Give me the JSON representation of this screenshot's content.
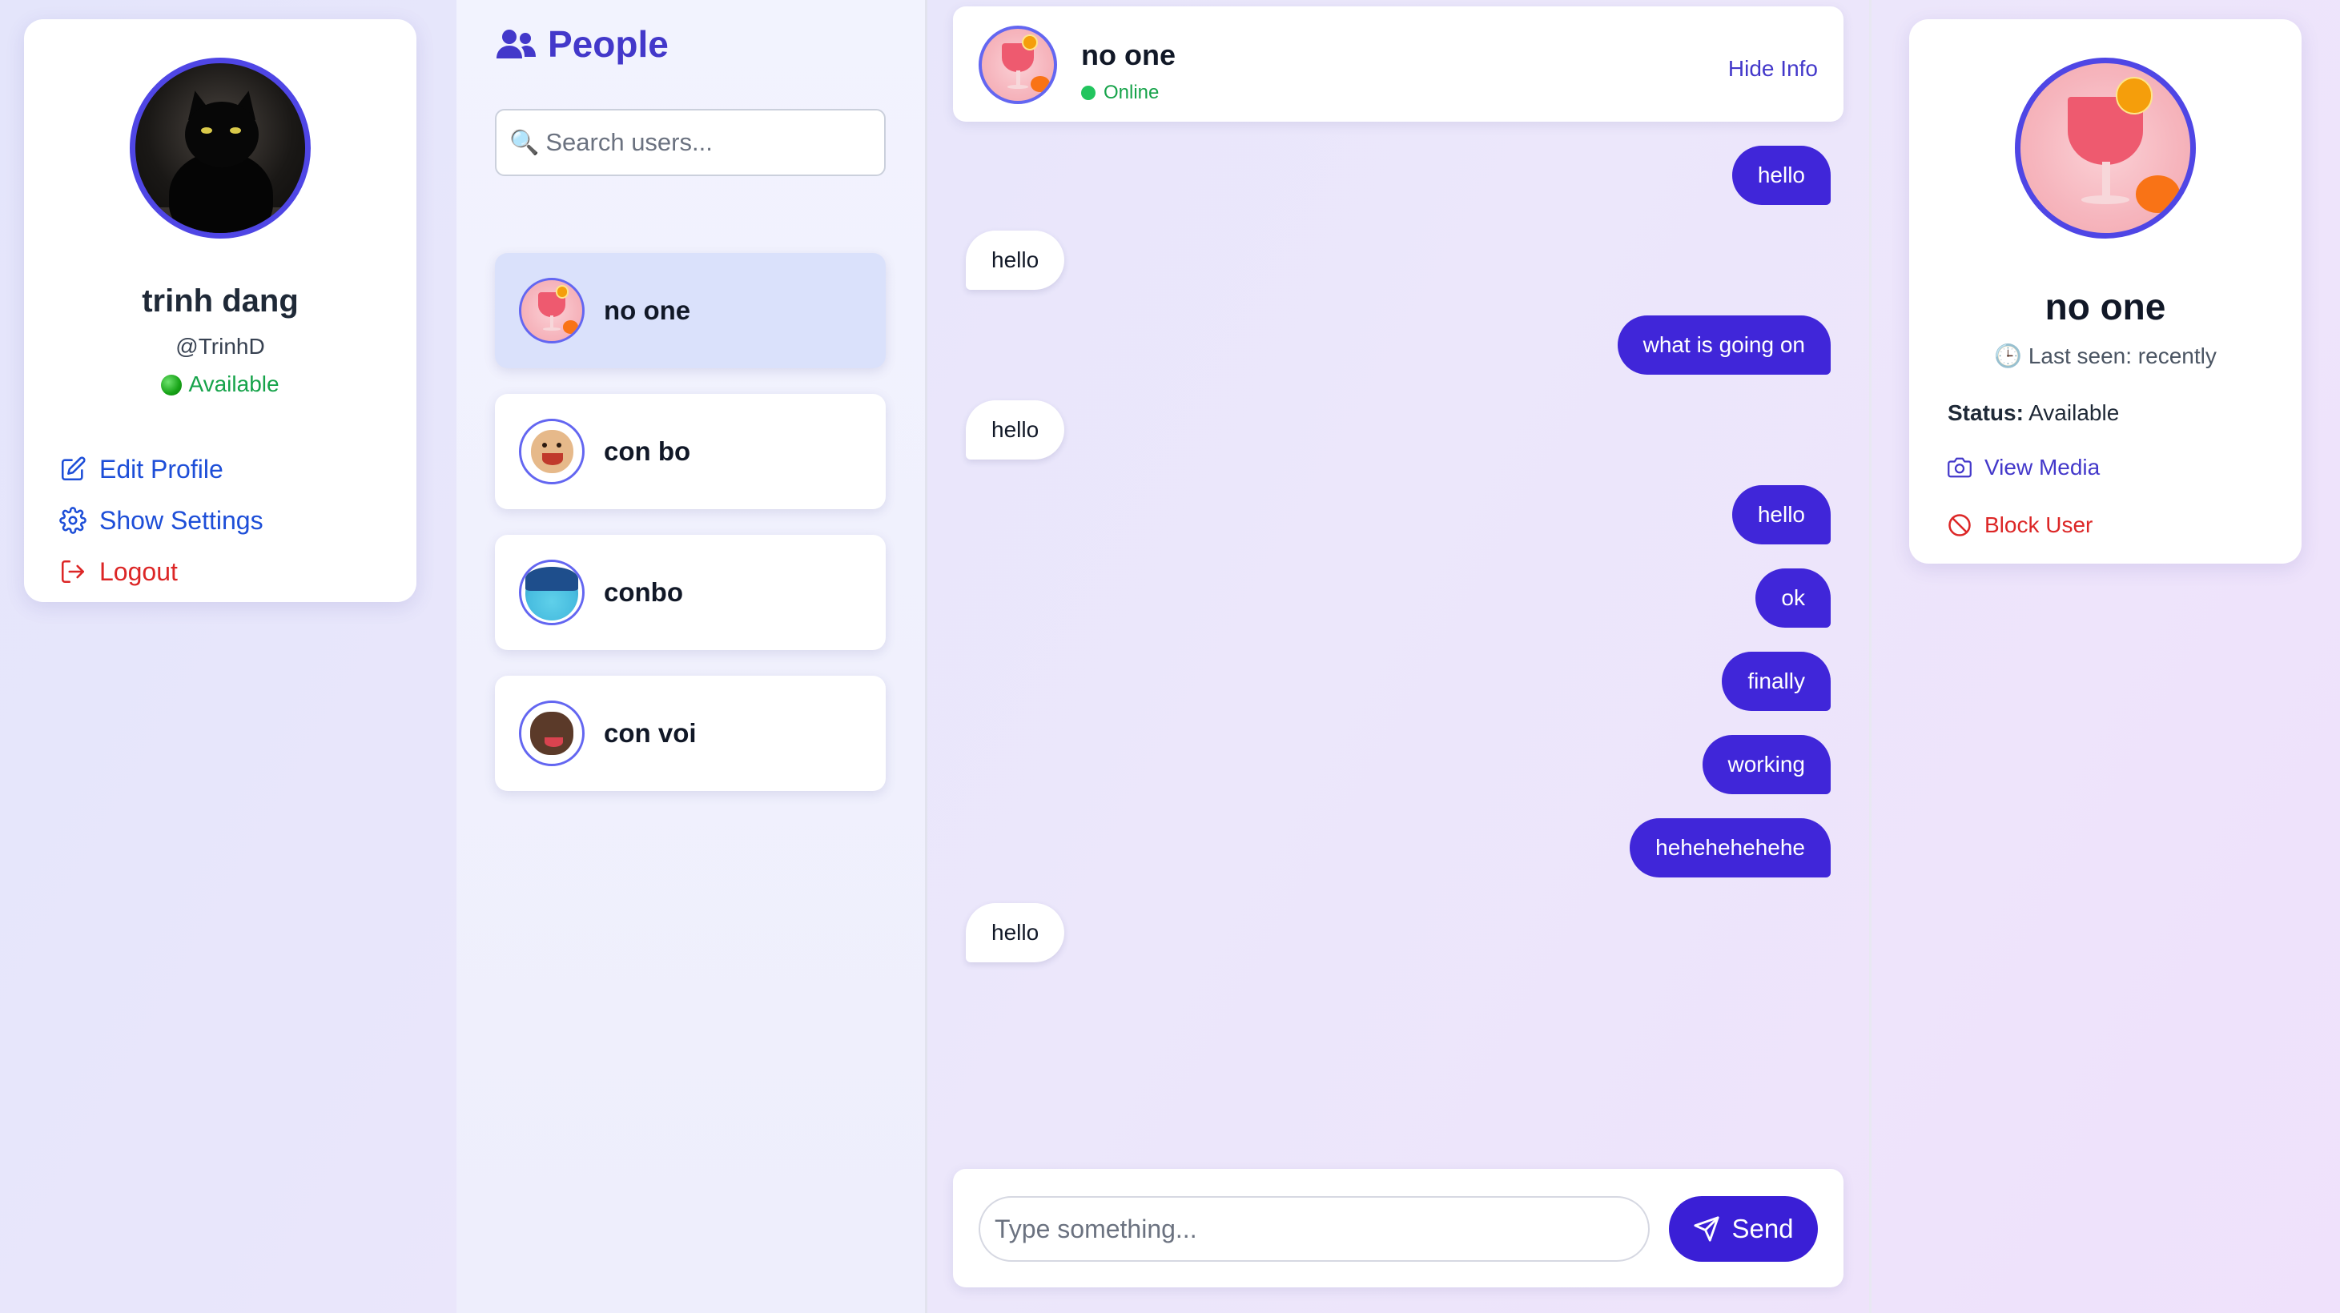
{
  "profile": {
    "name": "trinh dang",
    "handle": "@TrinhD",
    "status": "Available",
    "menu": {
      "edit": "Edit Profile",
      "settings": "Show Settings",
      "logout": "Logout"
    }
  },
  "people": {
    "title": "People",
    "search_placeholder": "Search users...",
    "users": [
      {
        "name": "no one",
        "active": true
      },
      {
        "name": "con bo",
        "active": false
      },
      {
        "name": "conbo",
        "active": false
      },
      {
        "name": "con voi",
        "active": false
      }
    ]
  },
  "chat": {
    "name": "no one",
    "status": "Online",
    "hide_info": "Hide Info",
    "messages": [
      {
        "text": "hello",
        "direction": "out"
      },
      {
        "text": "hello",
        "direction": "in"
      },
      {
        "text": "what is going on",
        "direction": "out"
      },
      {
        "text": "hello",
        "direction": "in"
      },
      {
        "text": "hello",
        "direction": "out"
      },
      {
        "text": "ok",
        "direction": "out"
      },
      {
        "text": "finally",
        "direction": "out"
      },
      {
        "text": "working",
        "direction": "out"
      },
      {
        "text": "hehehehehehe",
        "direction": "out"
      },
      {
        "text": "hello",
        "direction": "in"
      }
    ],
    "composer": {
      "placeholder": "Type something...",
      "send_label": "Send"
    }
  },
  "info": {
    "name": "no one",
    "last_seen": "Last seen: recently",
    "status_label": "Status:",
    "status_value": "Available",
    "view_media": "View Media",
    "block_user": "Block User"
  },
  "colors": {
    "accent": "#4f46e5",
    "bubble_out": "#4026d9",
    "online": "#16a34a",
    "danger": "#dc2626",
    "link": "#1d4ed8"
  }
}
